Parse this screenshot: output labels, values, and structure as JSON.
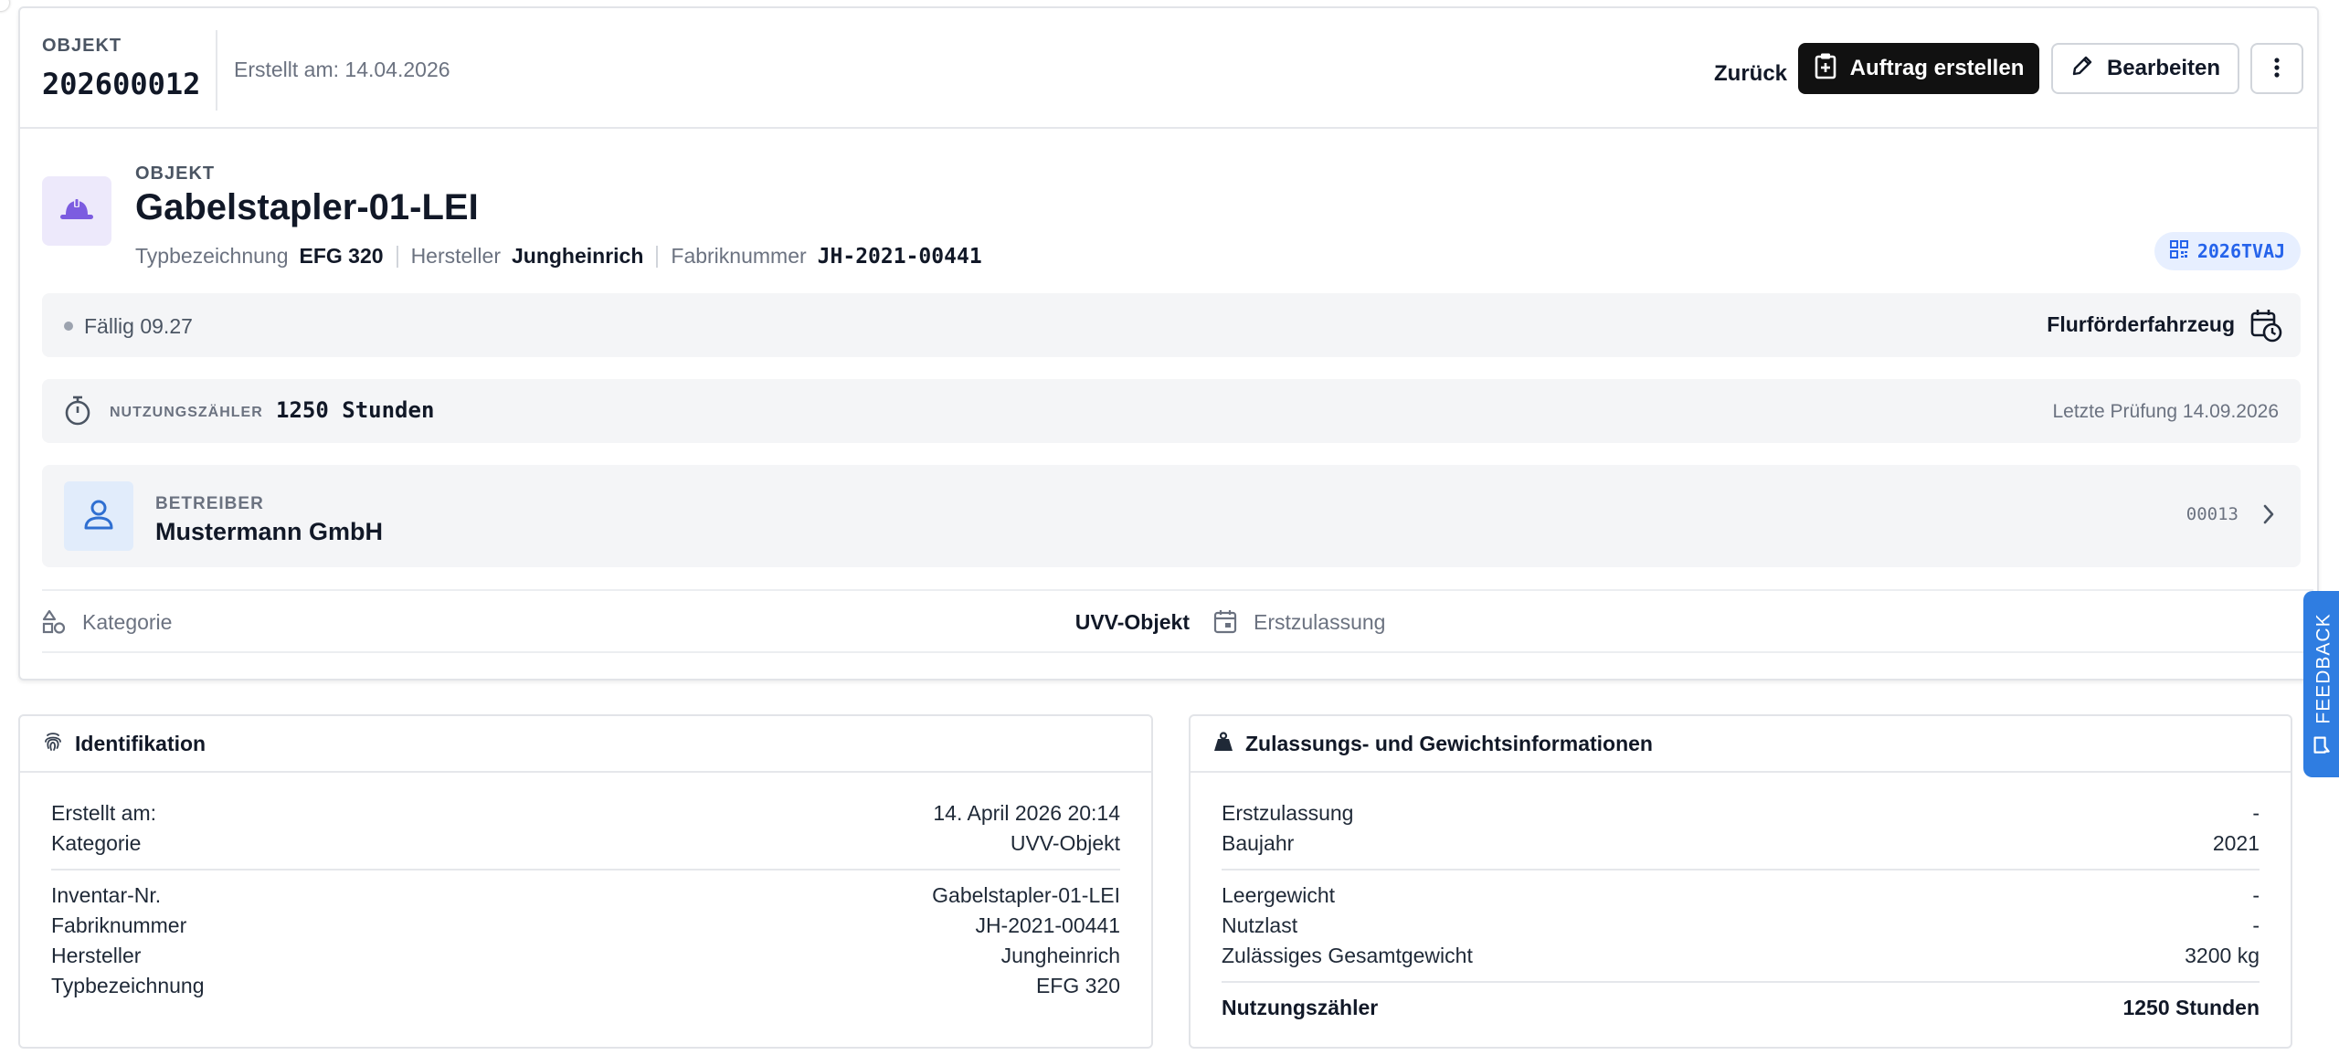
{
  "header": {
    "eyebrow": "OBJEKT",
    "object_number": "202600012",
    "created_text": "Erstellt am: 14.04.2026",
    "back_label": "Zurück",
    "create_order_label": "Auftrag erstellen",
    "edit_label": "Bearbeiten"
  },
  "object": {
    "eyebrow": "OBJEKT",
    "title": "Gabelstapler-01-LEI",
    "attributes": [
      {
        "key": "Typbezeichnung",
        "value": "EFG 320"
      },
      {
        "key": "Hersteller",
        "value": "Jungheinrich"
      },
      {
        "key": "Fabriknummer",
        "value": "JH-2021-00441"
      }
    ],
    "qr_code": "2026TVAJ"
  },
  "due": {
    "text": "Fällig 09.27",
    "vehicle_type": "Flurförderfahrzeug"
  },
  "counter": {
    "label": "NUTZUNGSZÄHLER",
    "value": "1250 Stunden",
    "last_check": "Letzte Prüfung 14.09.2026"
  },
  "operator": {
    "label": "BETREIBER",
    "name": "Mustermann GmbH",
    "code": "00013"
  },
  "category_row": {
    "category_label": "Kategorie",
    "category_value": "UVV-Objekt",
    "registration_label": "Erstzulassung",
    "registration_value": "-"
  },
  "identification": {
    "title": "Identifikation",
    "group1": [
      {
        "label": "Erstellt am:",
        "value": "14. April 2026 20:14"
      },
      {
        "label": "Kategorie",
        "value": "UVV-Objekt"
      }
    ],
    "group2": [
      {
        "label": "Inventar-Nr.",
        "value": "Gabelstapler-01-LEI"
      },
      {
        "label": "Fabriknummer",
        "value": "JH-2021-00441"
      },
      {
        "label": "Hersteller",
        "value": "Jungheinrich"
      },
      {
        "label": "Typbezeichnung",
        "value": "EFG 320"
      }
    ]
  },
  "approval": {
    "title": "Zulassungs- und Gewichtsinformationen",
    "group1": [
      {
        "label": "Erstzulassung",
        "value": "-"
      },
      {
        "label": "Baujahr",
        "value": "2021"
      }
    ],
    "group2": [
      {
        "label": "Leergewicht",
        "value": "-"
      },
      {
        "label": "Nutzlast",
        "value": "-"
      },
      {
        "label": "Zulässiges Gesamtgewicht",
        "value": "3200 kg"
      }
    ],
    "total": {
      "label": "Nutzungszähler",
      "value": "1250 Stunden"
    }
  },
  "feedback": {
    "label": "FEEDBACK"
  },
  "colors": {
    "primary_button": "#111111",
    "qr_chip_bg": "#e7efff",
    "qr_chip_text": "#2563eb",
    "object_icon_bg": "#ede9fb",
    "object_icon": "#7c5ce0",
    "operator_icon_bg": "#e1ecfb",
    "operator_icon": "#2f6fd1",
    "feedback_tab": "#2f7de1"
  }
}
